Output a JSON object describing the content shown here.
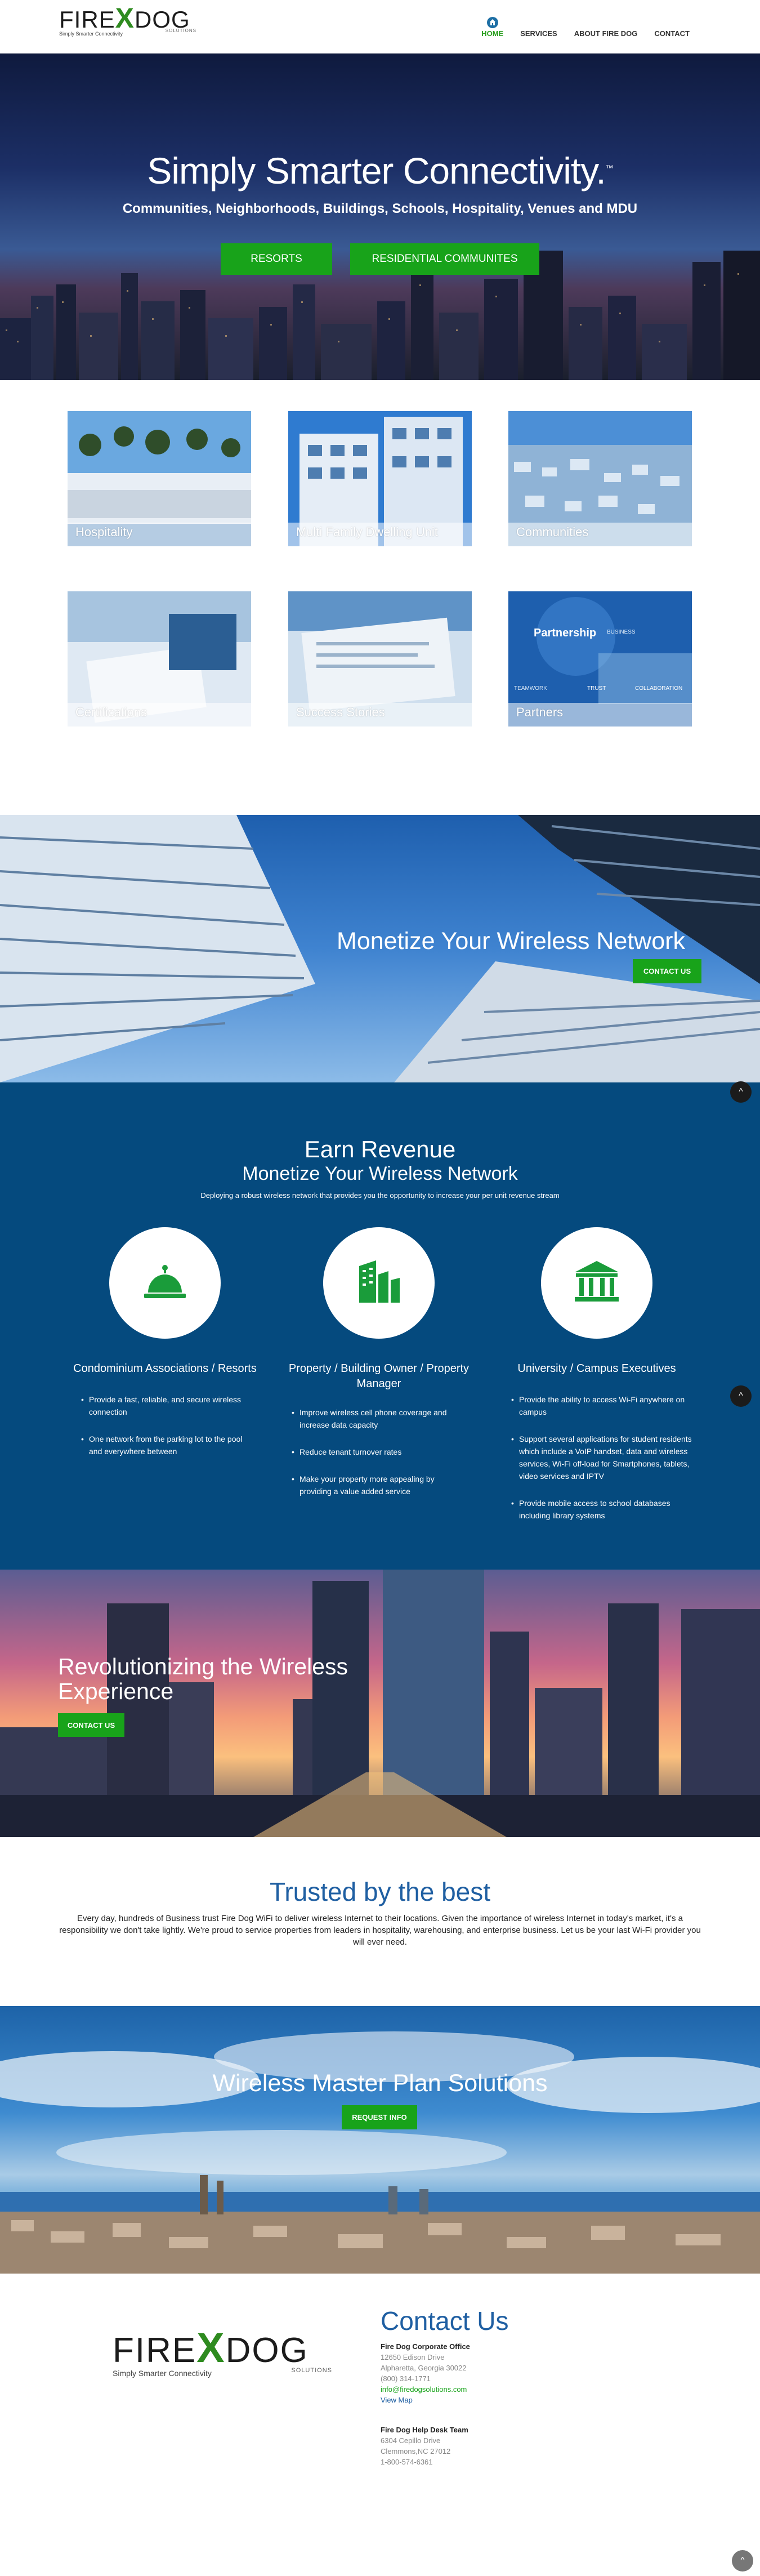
{
  "logo": {
    "brand_left": "FIRE",
    "brand_x": "X",
    "brand_right": "DOG",
    "tagline": "Simply Smarter Connectivity",
    "solutions": "SOLUTIONS"
  },
  "nav": {
    "items": [
      {
        "label": "HOME",
        "active": true
      },
      {
        "label": "SERVICES",
        "active": false
      },
      {
        "label": "ABOUT FIRE DOG",
        "active": false
      },
      {
        "label": "CONTACT",
        "active": false
      }
    ]
  },
  "hero": {
    "title": "Simply Smarter Connectivity.",
    "trademark": "™",
    "subtitle": "Communities, Neighborhoods, Buildings, Schools, Hospitality, Venues and MDU",
    "btn_resorts": "RESORTS",
    "btn_residential": "RESIDENTIAL COMMUNITES"
  },
  "tiles": [
    {
      "label": "Hospitality"
    },
    {
      "label": "Multi Family Dwelling Unit"
    },
    {
      "label": "Communities"
    },
    {
      "label": "Certifications"
    },
    {
      "label": "Success Stories"
    },
    {
      "label": "Partners"
    }
  ],
  "partners_words": {
    "partnership": "Partnership",
    "business": "BUSINESS",
    "teamwork": "TEAMWORK",
    "trust": "TRUST",
    "collaboration": "COLLABORATION"
  },
  "monetize": {
    "title": "Monetize Your Wireless Network",
    "button": "CONTACT US"
  },
  "earn": {
    "title": "Earn Revenue",
    "subtitle": "Monetize Your Wireless Network",
    "description": "Deploying a robust wireless network that provides you the opportunity to increase your per unit revenue stream",
    "columns": [
      {
        "title": "Condominium Associations / Resorts",
        "icon": "service-bell-icon",
        "items": [
          "Provide a fast, reliable, and secure wireless connection",
          "One network from the parking lot to the pool and everywhere between"
        ]
      },
      {
        "title": "Property / Building Owner / Property Manager",
        "icon": "building-icon",
        "items": [
          "Improve wireless cell phone coverage and increase data capacity",
          "Reduce tenant turnover rates",
          "Make your property more appealing by providing a value added service"
        ]
      },
      {
        "title": "University / Campus Executives",
        "icon": "university-icon",
        "items": [
          "Provide the ability to access Wi-Fi anywhere on campus",
          "Support several applications for student residents which include a VoIP handset, data and wireless services, Wi-Fi off-load for Smartphones, tablets, video services and IPTV",
          "Provide mobile access to school databases including library systems"
        ]
      }
    ],
    "scroll_icon": "^"
  },
  "revolution": {
    "title": "Revolutionizing the Wireless Experience",
    "button": "CONTACT US"
  },
  "trusted": {
    "title": "Trusted by the best",
    "text": "Every day, hundreds of Business trust Fire Dog WiFi to deliver wireless Internet to their locations. Given the importance of wireless Internet in today's market, it's a responsibility we don't take lightly. We're proud to service properties from leaders in hospitality, warehousing, and enterprise business. Let us be your last Wi-Fi provider you will ever need."
  },
  "wireless_master": {
    "title": "Wireless Master Plan Solutions",
    "button": "REQUEST INFO"
  },
  "footer": {
    "contact_title": "Contact Us",
    "office": {
      "heading": "Fire Dog Corporate Office",
      "address1": "12650 Edison Drive",
      "address2": "Alpharetta, Georgia 30022",
      "phone": "(800) 314-1771",
      "email": "info@firedogsolutions.com",
      "map": "View Map"
    },
    "helpdesk": {
      "heading": "Fire Dog Help Desk Team",
      "address1": "6304 Cepillo Drive",
      "address2": "Clemmons,NC 27012",
      "phone": "1-800-574-6361"
    }
  },
  "colors": {
    "green": "#18a31a",
    "blue_heading": "#1f5fa2",
    "earn_bg": "#054a7e"
  }
}
